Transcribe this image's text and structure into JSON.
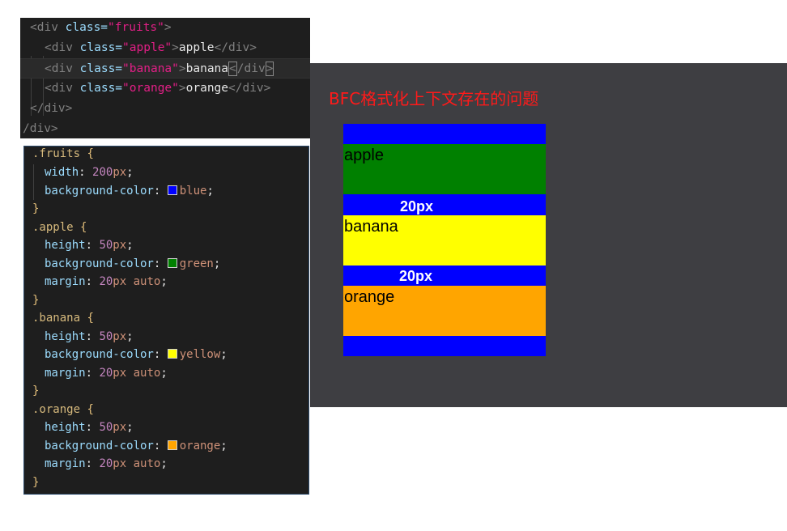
{
  "html_code": {
    "line1": {
      "tag_open": "<div ",
      "attr": "class=",
      "str": "\"fruits\"",
      "close": ">"
    },
    "line2": {
      "tag_open": "<div ",
      "attr": "class=",
      "str": "\"apple\"",
      "close": ">",
      "text": "apple",
      "end": "</div>"
    },
    "line3": {
      "tag_open": "<div ",
      "attr": "class=",
      "str": "\"banana\"",
      "close": ">",
      "text": "banana",
      "end_lt": "<",
      "end_mid": "/div",
      "end_gt": ">"
    },
    "line4": {
      "tag_open": "<div ",
      "attr": "class=",
      "str": "\"orange\"",
      "close": ">",
      "text": "orange",
      "end": "</div>"
    },
    "line5": "</div>",
    "line6": "/div>"
  },
  "css_code": {
    "fruits_selector": ".fruits",
    "width_prop": "width",
    "width_num": "200",
    "width_unit": "px",
    "bg_prop": "background-color",
    "fruits_bg": "blue",
    "apple_selector": ".apple",
    "apple_bg": "green",
    "banana_selector": ".banana",
    "banana_bg": "yellow",
    "orange_selector": ".orange",
    "orange_bg": "orange",
    "height_prop": "height",
    "height_num": "50",
    "margin_prop": "margin",
    "margin_num": "20",
    "margin_auto": "auto",
    "open_brace": "{",
    "close_brace": "}"
  },
  "preview": {
    "title": "BFC格式化上下文存在的问题",
    "apple": "apple",
    "banana": "banana",
    "orange": "orange",
    "gap1": "20px",
    "gap2": "20px"
  },
  "colors": {
    "blue": "#0000ff",
    "green": "#008000",
    "yellow": "#ffff00",
    "orange": "#ffa500",
    "title_red": "#ff1a1a"
  }
}
